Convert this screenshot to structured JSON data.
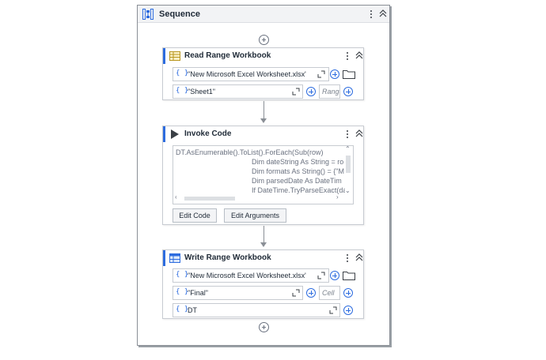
{
  "sequence": {
    "title": "Sequence",
    "icon": "sequence-icon"
  },
  "activities": [
    {
      "title": "Read Range Workbook",
      "icon": "excel-read-icon",
      "fields": [
        {
          "brace": "{ }",
          "value": "\"New Microsoft Excel Worksheet.xlsx\""
        },
        {
          "brace": "{ }",
          "value": "\"Sheet1\"",
          "side_placeholder": "Range"
        }
      ]
    },
    {
      "title": "Invoke Code",
      "icon": "play-icon",
      "code_lines": [
        "DT.AsEnumerable().ToList().ForEach(Sub(row)",
        "Dim dateString As String = ro",
        "Dim formats As String() = {\"M",
        "Dim parsedDate As DateTim",
        "If DateTime.TryParseExact(da"
      ],
      "buttons": [
        "Edit Code",
        "Edit Arguments"
      ]
    },
    {
      "title": "Write Range Workbook",
      "icon": "excel-write-icon",
      "fields": [
        {
          "brace": "{ }",
          "value": "\"New Microsoft Excel Worksheet.xlsx\""
        },
        {
          "brace": "{ }",
          "value": "\"Final\"",
          "side_placeholder": "Cell"
        },
        {
          "brace": "{ }",
          "value": "DT"
        }
      ]
    }
  ],
  "colors": {
    "accent": "#2d6cdf",
    "border": "#c7cbd1",
    "header_bg": "#f2f3f5"
  }
}
